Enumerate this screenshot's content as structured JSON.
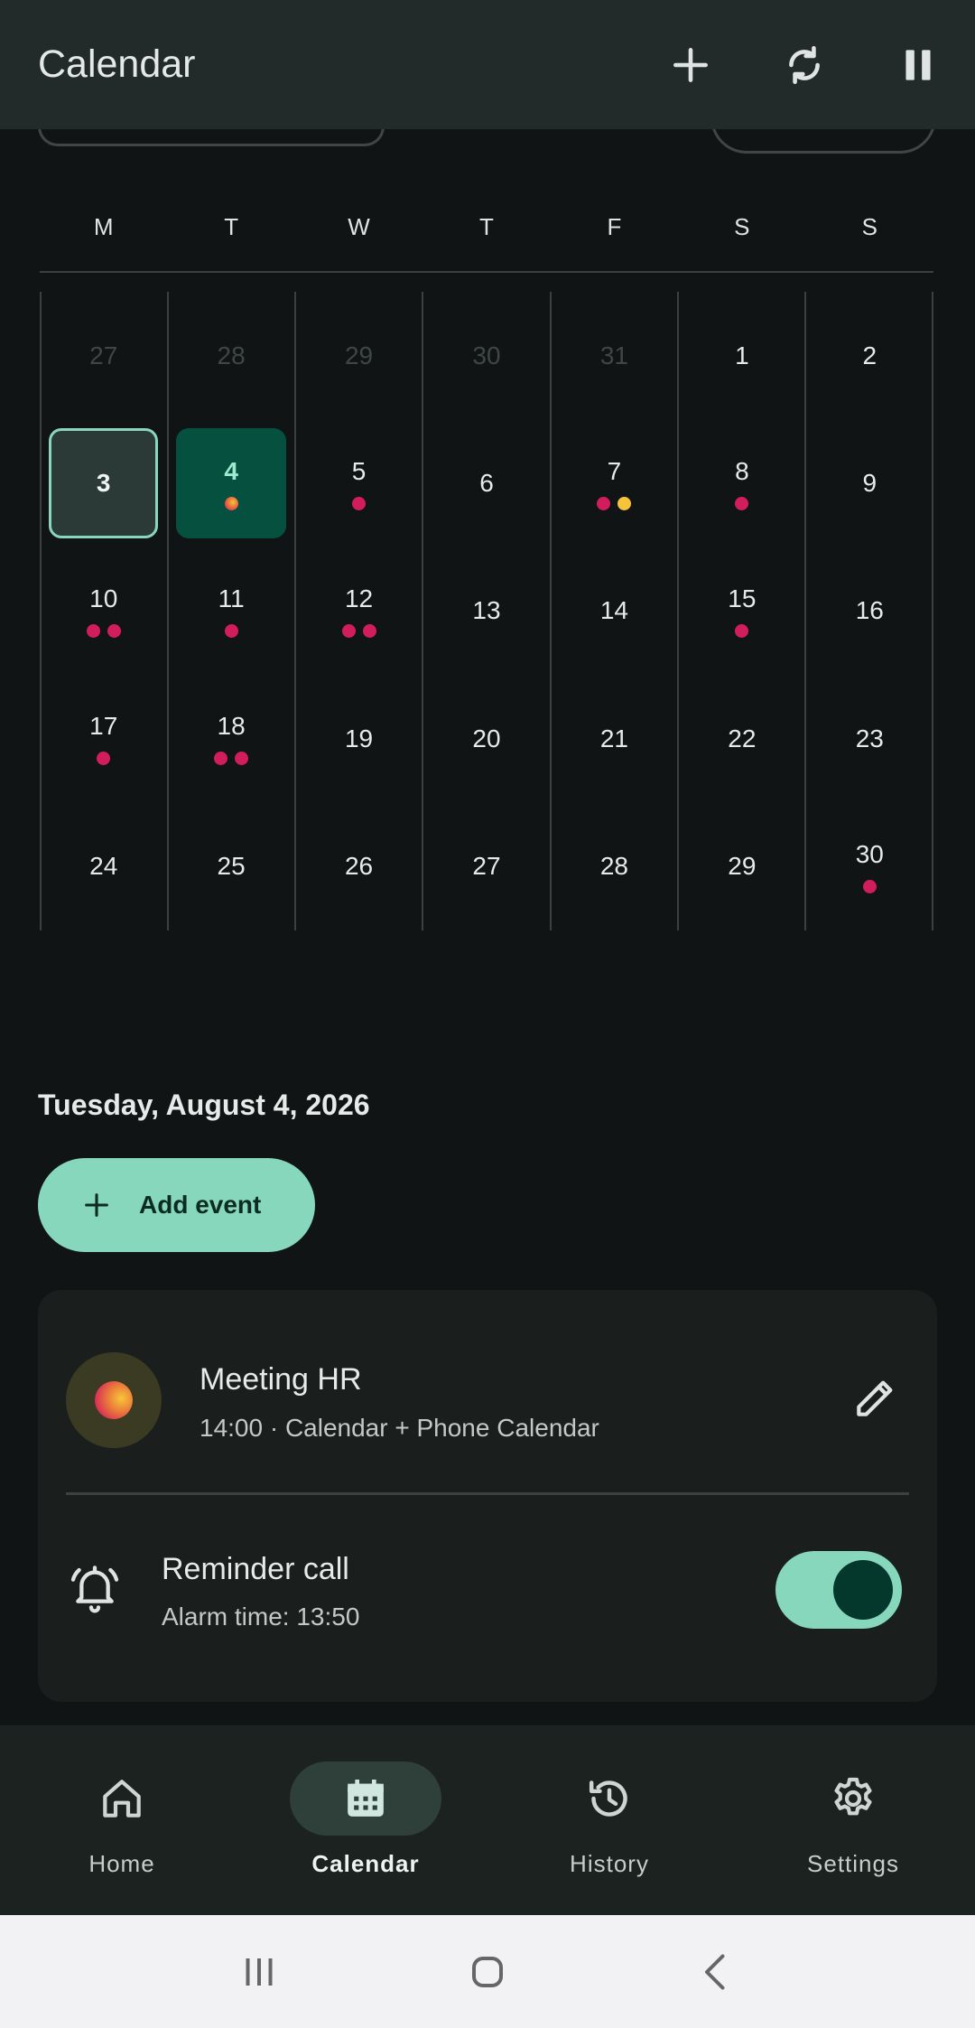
{
  "app": {
    "title": "Calendar",
    "actions": [
      "add-icon",
      "sync-icon",
      "pause-icon"
    ]
  },
  "calendar": {
    "weekdays": [
      "M",
      "T",
      "W",
      "T",
      "F",
      "S",
      "S"
    ],
    "days": [
      {
        "n": "27",
        "muted": true,
        "dots": []
      },
      {
        "n": "28",
        "muted": true,
        "dots": []
      },
      {
        "n": "29",
        "muted": true,
        "dots": []
      },
      {
        "n": "30",
        "muted": true,
        "dots": []
      },
      {
        "n": "31",
        "muted": true,
        "dots": []
      },
      {
        "n": "1",
        "dots": []
      },
      {
        "n": "2",
        "dots": []
      },
      {
        "n": "3",
        "today": true,
        "dots": []
      },
      {
        "n": "4",
        "selected": true,
        "dots": [
          "grad"
        ]
      },
      {
        "n": "5",
        "dots": [
          "pink"
        ]
      },
      {
        "n": "6",
        "dots": []
      },
      {
        "n": "7",
        "dots": [
          "pink",
          "yellow"
        ]
      },
      {
        "n": "8",
        "dots": [
          "pink"
        ]
      },
      {
        "n": "9",
        "dots": []
      },
      {
        "n": "10",
        "dots": [
          "pink",
          "pink"
        ]
      },
      {
        "n": "11",
        "dots": [
          "pink"
        ]
      },
      {
        "n": "12",
        "dots": [
          "pink",
          "pink"
        ]
      },
      {
        "n": "13",
        "dots": []
      },
      {
        "n": "14",
        "dots": []
      },
      {
        "n": "15",
        "dots": [
          "pink"
        ]
      },
      {
        "n": "16",
        "dots": []
      },
      {
        "n": "17",
        "dots": [
          "pink"
        ]
      },
      {
        "n": "18",
        "dots": [
          "pink",
          "pink"
        ]
      },
      {
        "n": "19",
        "dots": []
      },
      {
        "n": "20",
        "dots": []
      },
      {
        "n": "21",
        "dots": []
      },
      {
        "n": "22",
        "dots": []
      },
      {
        "n": "23",
        "dots": []
      },
      {
        "n": "24",
        "dots": []
      },
      {
        "n": "25",
        "dots": []
      },
      {
        "n": "26",
        "dots": []
      },
      {
        "n": "27",
        "dots": []
      },
      {
        "n": "28",
        "dots": []
      },
      {
        "n": "29",
        "dots": []
      },
      {
        "n": "30",
        "dots": [
          "pink"
        ]
      }
    ],
    "colors": {
      "event_dot": "#d21d5d",
      "alt_dot": "#f5c43a",
      "accent": "#86d7bb",
      "selected_bg": "#05503f"
    }
  },
  "selected_date": "Tuesday, August 4, 2026",
  "add_event_label": "Add event",
  "event": {
    "title": "Meeting HR",
    "subtitle": "14:00 · Calendar + Phone Calendar",
    "reminder_title": "Reminder call",
    "reminder_sub": "Alarm time: 13:50",
    "reminder_enabled": true
  },
  "nav": [
    {
      "label": "Home",
      "icon": "home-icon",
      "active": false
    },
    {
      "label": "Calendar",
      "icon": "calendar-icon",
      "active": true
    },
    {
      "label": "History",
      "icon": "history-icon",
      "active": false
    },
    {
      "label": "Settings",
      "icon": "settings-icon",
      "active": false
    }
  ]
}
